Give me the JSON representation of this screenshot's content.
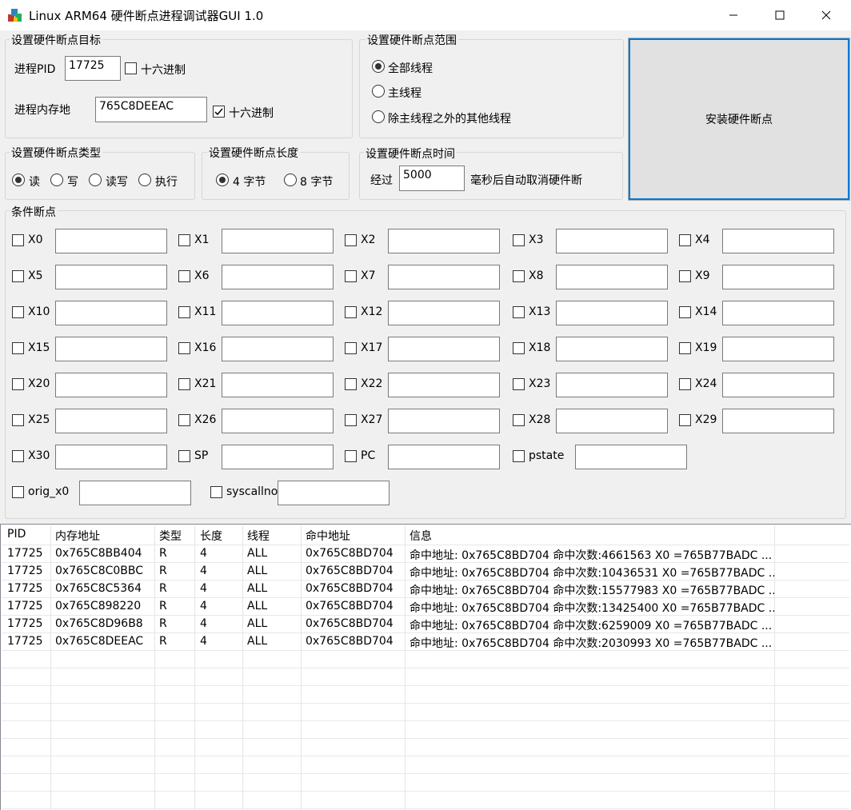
{
  "window": {
    "title": "Linux ARM64 硬件断点进程调试器GUI 1.0"
  },
  "target_group": {
    "legend": "设置硬件断点目标",
    "pid_label": "进程PID",
    "pid_value": "17725",
    "pid_hex_label": "十六进制",
    "pid_hex_checked": false,
    "addr_label": "进程内存地",
    "addr_value": "765C8DEEAC",
    "addr_hex_label": "十六进制",
    "addr_hex_checked": true
  },
  "scope_group": {
    "legend": "设置硬件断点范围",
    "options": [
      {
        "label": "全部线程",
        "selected": true
      },
      {
        "label": "主线程",
        "selected": false
      },
      {
        "label": "除主线程之外的其他线程",
        "selected": false
      }
    ]
  },
  "install_button": {
    "label": "安装硬件断点"
  },
  "type_group": {
    "legend": "设置硬件断点类型",
    "options": [
      {
        "label": "读",
        "selected": true
      },
      {
        "label": "写",
        "selected": false
      },
      {
        "label": "读写",
        "selected": false
      },
      {
        "label": "执行",
        "selected": false
      }
    ]
  },
  "length_group": {
    "legend": "设置硬件断点长度",
    "options": [
      {
        "label": "4 字节",
        "selected": true
      },
      {
        "label": "8 字节",
        "selected": false
      }
    ]
  },
  "time_group": {
    "legend": "设置硬件断点时间",
    "prefix": "经过",
    "value": "5000",
    "suffix": "毫秒后自动取消硬件断"
  },
  "cond_group": {
    "legend": "条件断点",
    "registers": [
      "X0",
      "X1",
      "X2",
      "X3",
      "X4",
      "X5",
      "X6",
      "X7",
      "X8",
      "X9",
      "X10",
      "X11",
      "X12",
      "X13",
      "X14",
      "X15",
      "X16",
      "X17",
      "X18",
      "X19",
      "X20",
      "X21",
      "X22",
      "X23",
      "X24",
      "X25",
      "X26",
      "X27",
      "X28",
      "X29",
      "X30",
      "SP",
      "PC",
      "pstate",
      "orig_x0",
      "syscallno"
    ]
  },
  "table": {
    "columns": [
      "PID",
      "内存地址",
      "类型",
      "长度",
      "线程",
      "命中地址",
      "信息"
    ],
    "rows": [
      [
        "17725",
        "0x765C8BB404",
        "R",
        "4",
        "ALL",
        "0x765C8BD704",
        "命中地址: 0x765C8BD704 命中次数:4661563 X0 =765B77BADC   ..."
      ],
      [
        "17725",
        "0x765C8C0BBC",
        "R",
        "4",
        "ALL",
        "0x765C8BD704",
        "命中地址: 0x765C8BD704 命中次数:10436531 X0 =765B77BADC ..."
      ],
      [
        "17725",
        "0x765C8C5364",
        "R",
        "4",
        "ALL",
        "0x765C8BD704",
        "命中地址: 0x765C8BD704 命中次数:15577983 X0 =765B77BADC ..."
      ],
      [
        "17725",
        "0x765C898220",
        "R",
        "4",
        "ALL",
        "0x765C8BD704",
        "命中地址: 0x765C8BD704 命中次数:13425400 X0 =765B77BADC ..."
      ],
      [
        "17725",
        "0x765C8D96B8",
        "R",
        "4",
        "ALL",
        "0x765C8BD704",
        "命中地址: 0x765C8BD704 命中次数:6259009 X0 =765B77BADC   ..."
      ],
      [
        "17725",
        "0x765C8DEEAC",
        "R",
        "4",
        "ALL",
        "0x765C8BD704",
        "命中地址: 0x765C8BD704 命中次数:2030993 X0 =765B77BADC   ..."
      ]
    ]
  }
}
